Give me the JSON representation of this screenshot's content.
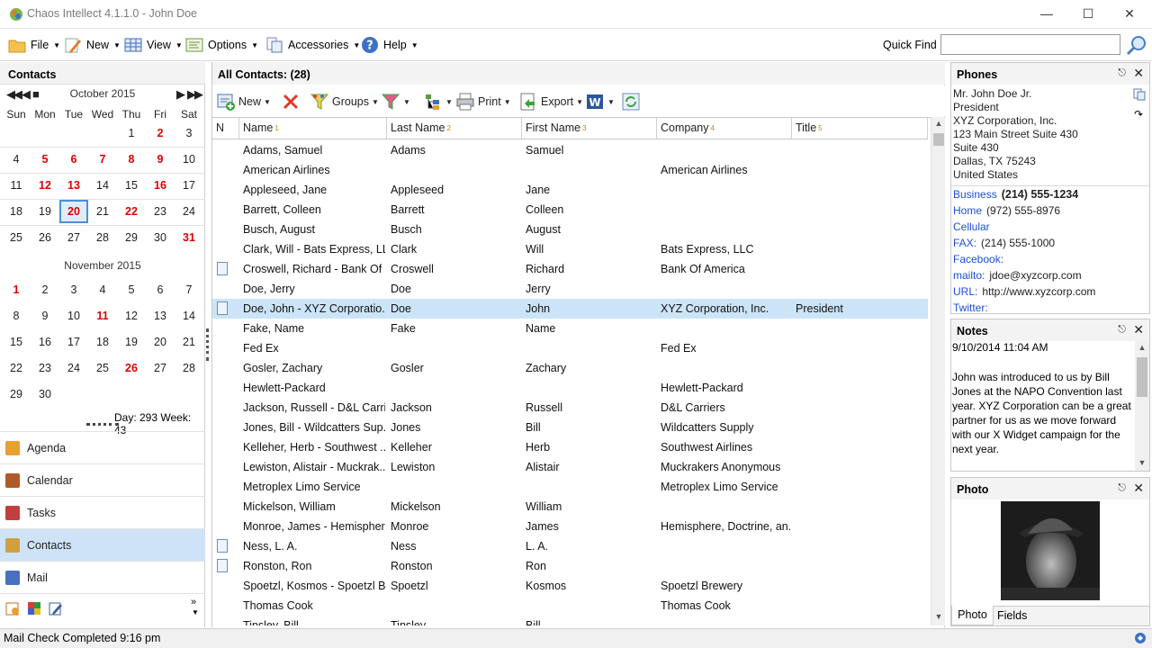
{
  "window": {
    "title": "Chaos Intellect 4.1.1.0 - John Doe"
  },
  "menu": {
    "file": "File",
    "new": "New",
    "view": "View",
    "options": "Options",
    "accessories": "Accessories",
    "help": "Help",
    "quick_find_label": "Quick Find",
    "quick_find_value": ""
  },
  "left": {
    "header": "Contacts",
    "month1": "October 2015",
    "month2": "November 2015",
    "dow": [
      "Sun",
      "Mon",
      "Tue",
      "Wed",
      "Thu",
      "Fri",
      "Sat"
    ],
    "oct_weeks": [
      [
        "",
        "",
        "",
        "",
        "1",
        "2",
        "3"
      ],
      [
        "4",
        "5",
        "6",
        "7",
        "8",
        "9",
        "10"
      ],
      [
        "11",
        "12",
        "13",
        "14",
        "15",
        "16",
        "17"
      ],
      [
        "18",
        "19",
        "20",
        "21",
        "22",
        "23",
        "24"
      ],
      [
        "25",
        "26",
        "27",
        "28",
        "29",
        "30",
        "31"
      ]
    ],
    "oct_red": [
      "2",
      "5",
      "6",
      "7",
      "8",
      "9",
      "12",
      "13",
      "16",
      "22",
      "31"
    ],
    "oct_selected": "20",
    "nov_weeks": [
      [
        "1",
        "2",
        "3",
        "4",
        "5",
        "6",
        "7"
      ],
      [
        "8",
        "9",
        "10",
        "11",
        "12",
        "13",
        "14"
      ],
      [
        "15",
        "16",
        "17",
        "18",
        "19",
        "20",
        "21"
      ],
      [
        "22",
        "23",
        "24",
        "25",
        "26",
        "27",
        "28"
      ],
      [
        "29",
        "30",
        "",
        "",
        "",
        "",
        ""
      ]
    ],
    "nov_red": [
      "1",
      "11",
      "26"
    ],
    "day_week": "Day: 293  Week: 43",
    "nav": [
      {
        "label": "Agenda",
        "icon": "agenda-icon",
        "color": "#e8a030"
      },
      {
        "label": "Calendar",
        "icon": "calendar-icon",
        "color": "#b05a2a"
      },
      {
        "label": "Tasks",
        "icon": "tasks-icon",
        "color": "#c04040"
      },
      {
        "label": "Contacts",
        "icon": "contacts-icon",
        "color": "#d0a040"
      },
      {
        "label": "Mail",
        "icon": "mail-icon",
        "color": "#4a70c0"
      }
    ]
  },
  "main": {
    "header": "All Contacts:  (28)",
    "toolbar": {
      "new": "New",
      "groups": "Groups",
      "print": "Print",
      "export": "Export"
    },
    "columns": [
      {
        "label": "N",
        "sort": ""
      },
      {
        "label": "Name",
        "sort": "1"
      },
      {
        "label": "Last Name",
        "sort": "2"
      },
      {
        "label": "First Name",
        "sort": "3"
      },
      {
        "label": "Company",
        "sort": "4"
      },
      {
        "label": "Title",
        "sort": "5"
      }
    ],
    "rows": [
      {
        "note": false,
        "name": "Adams, Samuel",
        "last": "Adams",
        "first": "Samuel",
        "company": "",
        "title": ""
      },
      {
        "note": false,
        "name": "American Airlines",
        "last": "",
        "first": "",
        "company": "American Airlines",
        "title": ""
      },
      {
        "note": false,
        "name": "Appleseed, Jane",
        "last": "Appleseed",
        "first": "Jane",
        "company": "",
        "title": ""
      },
      {
        "note": false,
        "name": "Barrett, Colleen",
        "last": "Barrett",
        "first": "Colleen",
        "company": "",
        "title": ""
      },
      {
        "note": false,
        "name": "Busch, August",
        "last": "Busch",
        "first": "August",
        "company": "",
        "title": ""
      },
      {
        "note": false,
        "name": "Clark, Will - Bats Express, LLC",
        "last": "Clark",
        "first": "Will",
        "company": "Bats Express, LLC",
        "title": ""
      },
      {
        "note": true,
        "name": "Croswell, Richard - Bank Of ...",
        "last": "Croswell",
        "first": "Richard",
        "company": "Bank Of America",
        "title": ""
      },
      {
        "note": false,
        "name": "Doe, Jerry",
        "last": "Doe",
        "first": "Jerry",
        "company": "",
        "title": ""
      },
      {
        "note": true,
        "name": "Doe, John - XYZ Corporatio...",
        "last": "Doe",
        "first": "John",
        "company": "XYZ Corporation, Inc.",
        "title": "President",
        "selected": true
      },
      {
        "note": false,
        "name": "Fake, Name",
        "last": "Fake",
        "first": "Name",
        "company": "",
        "title": ""
      },
      {
        "note": false,
        "name": "Fed Ex",
        "last": "",
        "first": "",
        "company": "Fed Ex",
        "title": ""
      },
      {
        "note": false,
        "name": "Gosler, Zachary",
        "last": "Gosler",
        "first": "Zachary",
        "company": "",
        "title": ""
      },
      {
        "note": false,
        "name": "Hewlett-Packard",
        "last": "",
        "first": "",
        "company": "Hewlett-Packard",
        "title": ""
      },
      {
        "note": false,
        "name": "Jackson, Russell - D&L  Carri...",
        "last": "Jackson",
        "first": "Russell",
        "company": "D&L  Carriers",
        "title": ""
      },
      {
        "note": false,
        "name": "Jones, Bill - Wildcatters Sup...",
        "last": "Jones",
        "first": "Bill",
        "company": "Wildcatters Supply",
        "title": ""
      },
      {
        "note": false,
        "name": "Kelleher, Herb - Southwest ...",
        "last": "Kelleher",
        "first": "Herb",
        "company": "Southwest Airlines",
        "title": ""
      },
      {
        "note": false,
        "name": "Lewiston, Alistair - Muckrak...",
        "last": "Lewiston",
        "first": "Alistair",
        "company": "Muckrakers Anonymous",
        "title": ""
      },
      {
        "note": false,
        "name": "Metroplex Limo Service",
        "last": "",
        "first": "",
        "company": "Metroplex Limo Service",
        "title": ""
      },
      {
        "note": false,
        "name": "Mickelson, William",
        "last": "Mickelson",
        "first": "William",
        "company": "",
        "title": ""
      },
      {
        "note": false,
        "name": "Monroe, James - Hemispher...",
        "last": "Monroe",
        "first": "James",
        "company": "Hemisphere, Doctrine, an...",
        "title": ""
      },
      {
        "note": true,
        "name": "Ness, L. A.",
        "last": "Ness",
        "first": "L. A.",
        "company": "",
        "title": ""
      },
      {
        "note": true,
        "name": "Ronston, Ron",
        "last": "Ronston",
        "first": "Ron",
        "company": "",
        "title": ""
      },
      {
        "note": false,
        "name": "Spoetzl, Kosmos - Spoetzl Br...",
        "last": "Spoetzl",
        "first": "Kosmos",
        "company": "Spoetzl Brewery",
        "title": ""
      },
      {
        "note": false,
        "name": "Thomas Cook",
        "last": "",
        "first": "",
        "company": "Thomas Cook",
        "title": ""
      },
      {
        "note": false,
        "name": "Tinsley, Bill",
        "last": "Tinsley",
        "first": "Bill",
        "company": "",
        "title": ""
      }
    ]
  },
  "phones": {
    "header": "Phones",
    "address": [
      "Mr. John Doe Jr.",
      "President",
      "XYZ Corporation, Inc.",
      "123 Main Street Suite 430",
      "Suite 430",
      "Dallas, TX 75243",
      "United States"
    ],
    "entries": [
      {
        "label": "Business",
        "value": "(214) 555-1234",
        "bold": true
      },
      {
        "label": "Home",
        "value": "(972) 555-8976"
      },
      {
        "label": "Cellular",
        "value": ""
      },
      {
        "label": "FAX:",
        "value": "(214) 555-1000"
      },
      {
        "label": "Facebook:",
        "value": ""
      },
      {
        "label": "mailto:",
        "value": "jdoe@xyzcorp.com"
      },
      {
        "label": "URL:",
        "value": "http://www.xyzcorp.com"
      },
      {
        "label": "Twitter:",
        "value": ""
      }
    ]
  },
  "notes": {
    "header": "Notes",
    "date": "9/10/2014 11:04 AM",
    "body": "John was introduced to us by Bill Jones at the NAPO Convention last year.  XYZ Corporation can be a great partner for us as we move forward with our X Widget campaign for the next year."
  },
  "photo": {
    "header": "Photo",
    "tabs": [
      "Photo",
      "Fields"
    ]
  },
  "status": {
    "text": "Mail Check Completed 9:16 pm"
  }
}
